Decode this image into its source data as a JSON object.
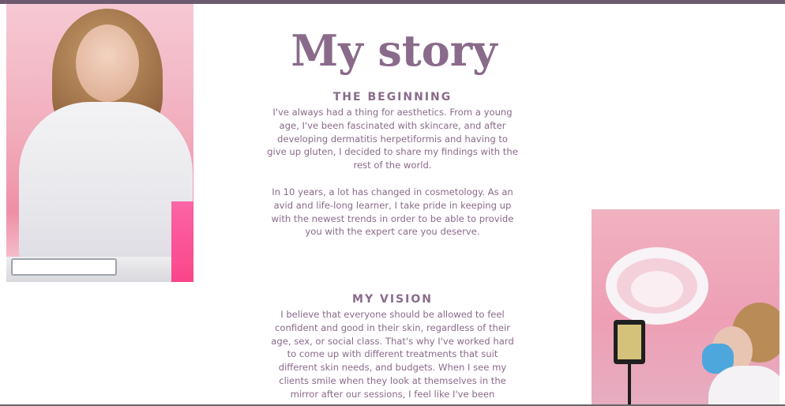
{
  "page": {
    "title": "My story",
    "accent_color": "#8a6a8b"
  },
  "sections": [
    {
      "heading": "THE BEGINNING",
      "paragraphs": [
        "I've always had a thing for aesthetics. From a young age, I've been fascinated with skincare, and after developing dermatitis herpetiformis and having to give up gluten, I decided to share my findings with the rest of the world.",
        "In 10 years, a lot has changed in cosmetology. As an avid and life-long learner, I take pride in keeping up with the newest trends in order to be able to provide you with the expert care you deserve."
      ]
    },
    {
      "heading": "MY VISION",
      "paragraphs": [
        "I believe that everyone should be allowed to feel confident and good in their skin, regardless of their age, sex, or social class. That's why I've worked hard to come up with different treatments that suit different skin needs, and budgets. When I see my clients smile when they look at themselves in the mirror after our sessions, I feel like I've been"
      ]
    }
  ],
  "images": {
    "left": "portrait-photo",
    "right": "treatment-photo"
  }
}
